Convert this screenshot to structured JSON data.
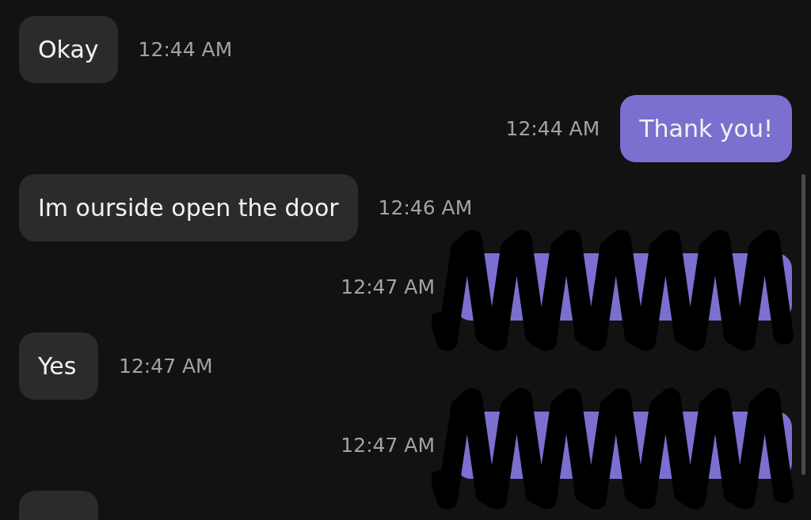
{
  "messages": [
    {
      "kind": "incoming",
      "text": "Okay",
      "time": "12:44 AM",
      "redacted": false
    },
    {
      "kind": "outgoing",
      "text": "Thank you!",
      "time": "12:44 AM",
      "redacted": false
    },
    {
      "kind": "incoming",
      "text": "Im ourside open the door",
      "time": "12:46 AM",
      "redacted": false
    },
    {
      "kind": "outgoing",
      "time": "12:47 AM",
      "redacted": true
    },
    {
      "kind": "incoming",
      "text": "Yes",
      "time": "12:47 AM",
      "redacted": false
    },
    {
      "kind": "outgoing",
      "time": "12:47 AM",
      "redacted": true
    },
    {
      "kind": "incoming",
      "redacted": false
    }
  ]
}
